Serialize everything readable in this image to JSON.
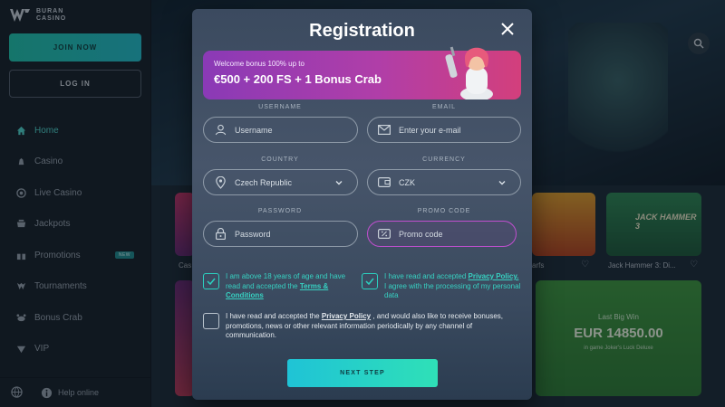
{
  "sidebar": {
    "logo_line1": "BURAN",
    "logo_line2": "CASINO",
    "join_label": "JOIN NOW",
    "login_label": "LOG IN",
    "items": [
      {
        "label": "Home",
        "icon": "home-icon",
        "active": true
      },
      {
        "label": "Casino",
        "icon": "casino-icon"
      },
      {
        "label": "Live Casino",
        "icon": "live-casino-icon"
      },
      {
        "label": "Jackpots",
        "icon": "jackpots-icon"
      },
      {
        "label": "Promotions",
        "icon": "promotions-icon",
        "badge": "NEW"
      },
      {
        "label": "Tournaments",
        "icon": "tournaments-icon"
      },
      {
        "label": "Bonus Crab",
        "icon": "bonus-crab-icon"
      },
      {
        "label": "VIP",
        "icon": "vip-icon"
      }
    ],
    "help_label": "Help online"
  },
  "background": {
    "tiles": [
      {
        "label": "Cas"
      },
      {
        "label": "arfs"
      },
      {
        "label": "Jack Hammer 3: Di..."
      }
    ],
    "jack_hammer_title": "JACK HAMMER 3",
    "big_win": {
      "label": "Last Big Win",
      "amount": "EUR 14850.00",
      "game": "in game Joker's Luck Deluxe"
    }
  },
  "modal": {
    "title": "Registration",
    "banner_small": "Welcome bonus 100% up to",
    "banner_big": "€500 + 200 FS + 1 Bonus Crab",
    "fields": {
      "username": {
        "label": "USERNAME",
        "placeholder": "Username"
      },
      "email": {
        "label": "EMAIL",
        "placeholder": "Enter your e-mail"
      },
      "country": {
        "label": "COUNTRY",
        "value": "Czech Republic"
      },
      "currency": {
        "label": "CURRENCY",
        "value": "CZK"
      },
      "password": {
        "label": "PASSWORD",
        "placeholder": "Password"
      },
      "promo": {
        "label": "PROMO CODE",
        "placeholder": "Promo code"
      }
    },
    "checks": {
      "age_text1": "I am above 18 years of age and have read and accepted the ",
      "age_link": "Terms & Conditions",
      "privacy_text1": "I have read and accepted ",
      "privacy_link": "Privacy Policy.",
      "privacy_text2": " I agree with the processing of my personal data",
      "marketing_text1": "I have read and accepted the ",
      "marketing_link": "Privacy Policy",
      "marketing_text2": " , and would also like to receive bonuses, promotions, news or other relevant information periodically by any channel of communication."
    },
    "next_label": "NEXT STEP"
  },
  "colors": {
    "accent": "#2bd1c0",
    "banner_start": "#8a3ab6",
    "banner_end": "#d33f7c",
    "promo_border": "#c04fcf"
  }
}
